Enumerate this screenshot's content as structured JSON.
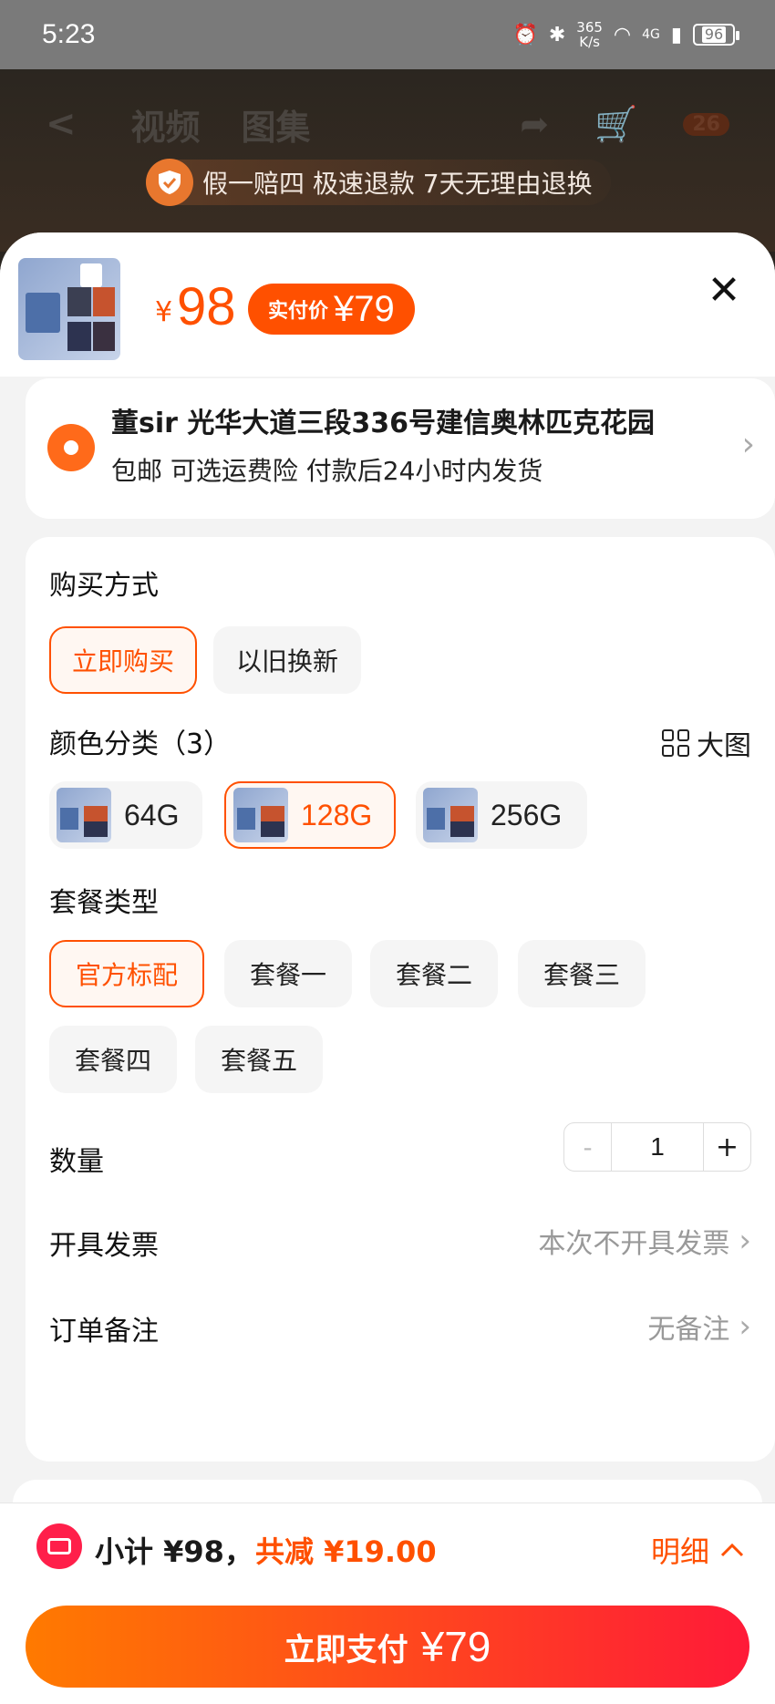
{
  "status_bar": {
    "time": "5:23",
    "net_speed_value": "365",
    "net_speed_unit": "K/s",
    "network": "4G",
    "battery": "96"
  },
  "background_page": {
    "back": "<",
    "tabs": [
      "视频",
      "图集"
    ],
    "cart_badge": "26"
  },
  "guarantee": {
    "text": "假一赔四 极速退款 7天无理由退换"
  },
  "header": {
    "currency": "¥",
    "price": "98",
    "paid_price_label": "实付价",
    "paid_price": "¥79",
    "close": "✕"
  },
  "address": {
    "line1": "董sir 光华大道三段336号建信奥林匹克花园",
    "line2": "包邮  可选运费险  付款后24小时内发货"
  },
  "purchase_method": {
    "title": "购买方式",
    "options": [
      "立即购买",
      "以旧换新"
    ],
    "selected": 0
  },
  "color": {
    "title": "颜色分类（3）",
    "big_image_label": "大图",
    "options": [
      "64G",
      "128G",
      "256G"
    ],
    "selected": 1
  },
  "package": {
    "title": "套餐类型",
    "options": [
      "官方标配",
      "套餐一",
      "套餐二",
      "套餐三",
      "套餐四",
      "套餐五"
    ],
    "selected": 0
  },
  "quantity": {
    "title": "数量",
    "minus": "-",
    "value": "1",
    "plus": "+"
  },
  "invoice": {
    "title": "开具发票",
    "value": "本次不开具发票"
  },
  "note": {
    "title": "订单备注",
    "value": "无备注"
  },
  "bottom": {
    "subtotal": "小计 ¥98，",
    "discount": "共减 ¥19.00",
    "detail": "明细",
    "pay_label": "立即支付",
    "pay_amount": "¥79"
  },
  "colors": {
    "accent": "#ff5000",
    "pay_gradient_start": "#ff7a00",
    "pay_gradient_end": "#ff1a38"
  }
}
